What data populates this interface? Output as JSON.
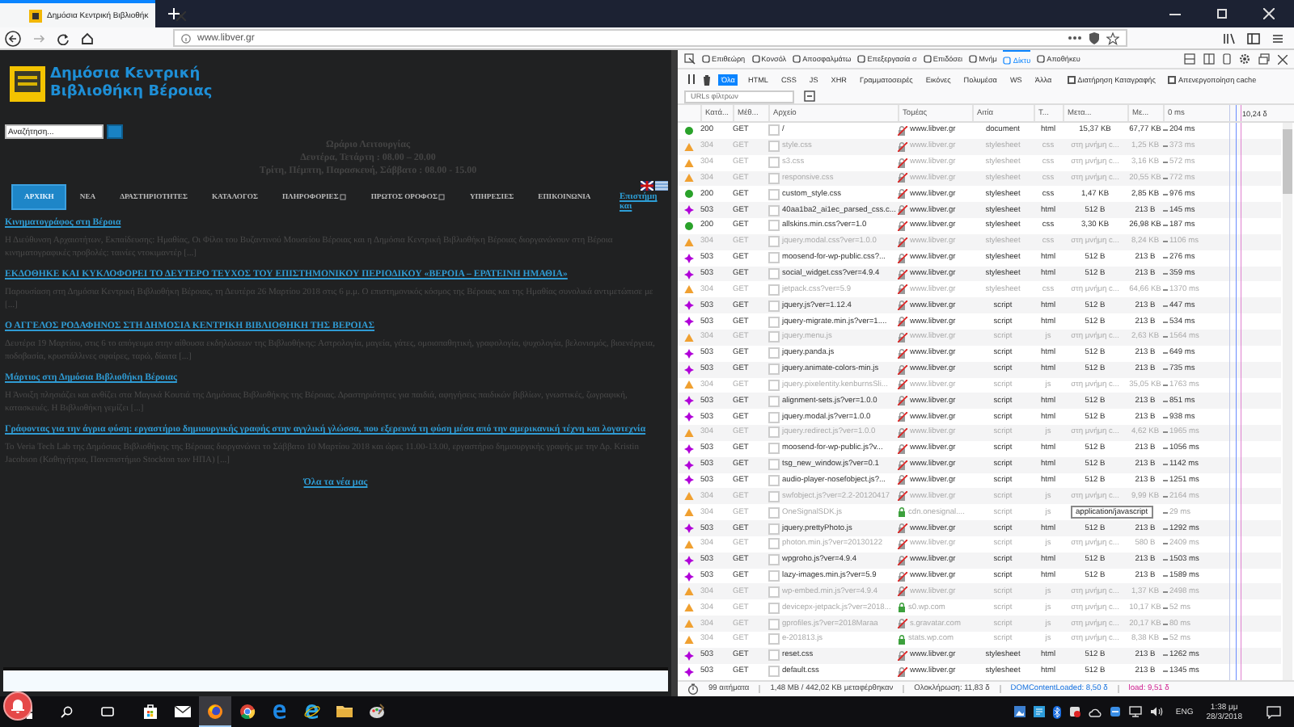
{
  "browser": {
    "tab_title": "Δημόσια Κεντρική Βιβλιοθήκ",
    "url": "www.libver.gr"
  },
  "site": {
    "logo_lines": [
      "Δημόσια Κεντρική",
      "Βιβλιοθήκη Βέροιας"
    ],
    "search_placeholder": "Αναζήτηση...",
    "hours": [
      "Ωράριο Λειτουργίας",
      "Δευτέρα, Τετάρτη : 08.00 – 20.00",
      "Τρίτη, Πέμπτη, Παρασκευή, Σάββατο : 08.00 - 15.00"
    ],
    "nav": [
      {
        "label": "ΑΡΧΙΚΗ",
        "selected": true,
        "submenu": false
      },
      {
        "label": "ΝΕΑ",
        "selected": false,
        "submenu": false
      },
      {
        "label": "ΔΡΑΣΤΗΡΙΟΤΗΤΕΣ",
        "selected": false,
        "submenu": false
      },
      {
        "label": "ΚΑΤΑΛΟΓΟΣ",
        "selected": false,
        "submenu": false
      },
      {
        "label": "ΠΛΗΡΟΦΟΡΙΕΣ",
        "selected": false,
        "submenu": true
      },
      {
        "label": "ΠΡΩΤΟΣ ΟΡΟΦΟΣ",
        "selected": false,
        "submenu": true
      },
      {
        "label": "ΥΠΗΡΕΣΙΕΣ",
        "selected": false,
        "submenu": false
      },
      {
        "label": "ΕΠΙΚΟΙΝΩΝΙΑ",
        "selected": false,
        "submenu": false
      }
    ],
    "side_link": "Επιστήμη και",
    "news": [
      {
        "title": "Κινηματογράφος στη Βέροια",
        "excerpt": "Η Διεύθυνση Αρχαιοτήτων, Εκπαίδευσης: Ημαθίας, Οι Φίλοι του Βυζαντινού Μουσείου Βέροιας και η Δημόσια Κεντρική Βιβλιοθήκη Βέροιας διοργανώνουν στη Βέροια κινηματογραφικές προβολές: ταινίες ντοκιμαντέρ [...]"
      },
      {
        "title": "ΕΚΔΟΘΗΚΕ ΚΑΙ ΚΥΚΛΟΦΟΡΕΙ ΤΟ ΔΕΥΤΕΡΟ ΤΕΥΧΟΣ ΤΟΥ ΕΠΙΣΤΗΜΟΝΙΚΟΥ ΠΕΡΙΟΔΙΚΟΥ «ΒΕΡΟΙΑ – ΕΡΑΤΕΙΝΗ ΗΜΑΘΙΑ»",
        "excerpt": "Παρουσίαση στη Δημόσια Κεντρική Βιβλιοθήκη Βέροιας, τη Δευτέρα 26 Μαρτίου 2018 στις 6 μ.μ. Ο επιστημονικός κόσμος της Βέροιας και της Ημαθίας συνολικά αντιμετώπισε με [...]"
      },
      {
        "title": "Ο ΑΓΓΕΛΟΣ ΡΟΔΑΦΗΝΟΣ ΣΤΗ ΔΗΜΟΣΙΑ ΚΕΝΤΡΙΚΗ ΒΙΒΛΙΟΘΗΚΗ ΤΗΣ ΒΕΡΟΙΑΣ",
        "excerpt": "Δευτέρα 19 Μαρτίου, στις 6 το απόγευμα στην αίθουσα εκδηλώσεων της Βιβλιοθήκης: Αστρολογία, μαγεία, γάτες, ομοιοπαθητική, γραφολογία, ψυχολογία, βελονισμός, βιοενέργεια, ποδοβασία, κρυστάλλινες σφαίρες, ταρώ, δίαιτα [...]"
      },
      {
        "title": "Μάρτιος στη Δημόσια Βιβλιοθήκη Βέροιας",
        "excerpt": "Η Άνοιξη πλησιάζει και ανθίζει στα Μαγικά Κουτιά της Δημόσιας Βιβλιοθήκης της Βέροιας. Δραστηριότητες για παιδιά, αφηγήσεις παιδικών βιβλίων, γνωστικές, ζωγραφική, κατασκευές. Η Βιβλιοθήκη γεμίζει [...]"
      },
      {
        "title": "Γράφοντας για την άγρια φύση: εργαστήριο δημιουργικής γραφής στην αγγλική γλώσσα, που εξερευνά τη φύση μέσα από την αμερικανική τέχνη και λογοτεχνία",
        "excerpt": "Το Veria Tech Lab της Δημόσιας Βιβλιοθήκης της Βέροιας διοργανώνει το Σάββατο 10 Μαρτίου 2018 και ώρες 11.00-13.00, εργαστήριο δημιουργικής γραφής με την Δρ. Kristin Jacobson (Καθηγήτρια, Πανεπιστήμιο Stockton των ΗΠΑ) [...]"
      }
    ],
    "all_news": "Όλα τα νέα μας"
  },
  "devtools": {
    "tools": [
      {
        "label": "Επιθεώρη",
        "selected": false
      },
      {
        "label": "Κονσόλ",
        "selected": false
      },
      {
        "label": "Αποσφαλμάτω",
        "selected": false
      },
      {
        "label": "Επεξεργασία σ",
        "selected": false
      },
      {
        "label": "Επιδόσει",
        "selected": false
      },
      {
        "label": "Μνήμ",
        "selected": false
      },
      {
        "label": "Δίκτυ",
        "selected": true
      },
      {
        "label": "Αποθήκευ",
        "selected": false
      }
    ],
    "filters": [
      {
        "label": "Όλα",
        "selected": true
      },
      {
        "label": "HTML",
        "selected": false
      },
      {
        "label": "CSS",
        "selected": false
      },
      {
        "label": "JS",
        "selected": false
      },
      {
        "label": "XHR",
        "selected": false
      },
      {
        "label": "Γραμματοσειρές",
        "selected": false
      },
      {
        "label": "Εικόνες",
        "selected": false
      },
      {
        "label": "Πολυμέσα",
        "selected": false
      },
      {
        "label": "WS",
        "selected": false
      },
      {
        "label": "Άλλα",
        "selected": false
      }
    ],
    "options": [
      {
        "label": "Διατήρηση Καταγραφής",
        "checked": false
      },
      {
        "label": "Απενεργοποίηση cache",
        "checked": false
      }
    ],
    "url_filter_placeholder": "URLs φίλτρων",
    "columns": [
      "Κατά...",
      "Μέθ...",
      "Αρχείο",
      "Τομέας",
      "Αιτία",
      "Τ...",
      "Μετα...",
      "Με...",
      "0 ms"
    ],
    "timeline_label": "10,24 δ",
    "requests": [
      {
        "kind": "ok",
        "status": "200",
        "method": "GET",
        "file": "/",
        "domain": "www.libver.gr",
        "secure": false,
        "cause": "document",
        "type": "html",
        "transferred": "15,37 KB",
        "size": "67,77 KB",
        "time": "204 ms"
      },
      {
        "kind": "cached",
        "status": "304",
        "method": "GET",
        "file": "style.css",
        "domain": "www.libver.gr",
        "secure": false,
        "cause": "stylesheet",
        "type": "css",
        "transferred": "στη μνήμη c...",
        "size": "1,25 KB",
        "time": "373 ms"
      },
      {
        "kind": "cached",
        "status": "304",
        "method": "GET",
        "file": "s3.css",
        "domain": "www.libver.gr",
        "secure": false,
        "cause": "stylesheet",
        "type": "css",
        "transferred": "στη μνήμη c...",
        "size": "3,16 KB",
        "time": "572 ms"
      },
      {
        "kind": "cached",
        "status": "304",
        "method": "GET",
        "file": "responsive.css",
        "domain": "www.libver.gr",
        "secure": false,
        "cause": "stylesheet",
        "type": "css",
        "transferred": "στη μνήμη c...",
        "size": "20,55 KB",
        "time": "772 ms"
      },
      {
        "kind": "ok",
        "status": "200",
        "method": "GET",
        "file": "custom_style.css",
        "domain": "www.libver.gr",
        "secure": false,
        "cause": "stylesheet",
        "type": "css",
        "transferred": "1,47 KB",
        "size": "2,85 KB",
        "time": "976 ms"
      },
      {
        "kind": "error",
        "status": "503",
        "method": "GET",
        "file": "40aa1ba2_ai1ec_parsed_css.c...",
        "domain": "www.libver.gr",
        "secure": false,
        "cause": "stylesheet",
        "type": "html",
        "transferred": "512 B",
        "size": "213 B",
        "time": "145 ms"
      },
      {
        "kind": "ok",
        "status": "200",
        "method": "GET",
        "file": "allskins.min.css?ver=1.0",
        "domain": "www.libver.gr",
        "secure": false,
        "cause": "stylesheet",
        "type": "css",
        "transferred": "3,30 KB",
        "size": "26,98 KB",
        "time": "187 ms"
      },
      {
        "kind": "cached",
        "status": "304",
        "method": "GET",
        "file": "jquery.modal.css?ver=1.0.0",
        "domain": "www.libver.gr",
        "secure": false,
        "cause": "stylesheet",
        "type": "css",
        "transferred": "στη μνήμη c...",
        "size": "8,24 KB",
        "time": "1106 ms"
      },
      {
        "kind": "error",
        "status": "503",
        "method": "GET",
        "file": "moosend-for-wp-public.css?...",
        "domain": "www.libver.gr",
        "secure": false,
        "cause": "stylesheet",
        "type": "html",
        "transferred": "512 B",
        "size": "213 B",
        "time": "276 ms"
      },
      {
        "kind": "error",
        "status": "503",
        "method": "GET",
        "file": "social_widget.css?ver=4.9.4",
        "domain": "www.libver.gr",
        "secure": false,
        "cause": "stylesheet",
        "type": "html",
        "transferred": "512 B",
        "size": "213 B",
        "time": "359 ms"
      },
      {
        "kind": "cached",
        "status": "304",
        "method": "GET",
        "file": "jetpack.css?ver=5.9",
        "domain": "www.libver.gr",
        "secure": false,
        "cause": "stylesheet",
        "type": "css",
        "transferred": "στη μνήμη c...",
        "size": "64,66 KB",
        "time": "1370 ms"
      },
      {
        "kind": "error",
        "status": "503",
        "method": "GET",
        "file": "jquery.js?ver=1.12.4",
        "domain": "www.libver.gr",
        "secure": false,
        "cause": "script",
        "type": "html",
        "transferred": "512 B",
        "size": "213 B",
        "time": "447 ms"
      },
      {
        "kind": "error",
        "status": "503",
        "method": "GET",
        "file": "jquery-migrate.min.js?ver=1....",
        "domain": "www.libver.gr",
        "secure": false,
        "cause": "script",
        "type": "html",
        "transferred": "512 B",
        "size": "213 B",
        "time": "534 ms"
      },
      {
        "kind": "cached",
        "status": "304",
        "method": "GET",
        "file": "jquery.menu.js",
        "domain": "www.libver.gr",
        "secure": false,
        "cause": "script",
        "type": "js",
        "transferred": "στη μνήμη c...",
        "size": "2,63 KB",
        "time": "1564 ms"
      },
      {
        "kind": "error",
        "status": "503",
        "method": "GET",
        "file": "jquery.panda.js",
        "domain": "www.libver.gr",
        "secure": false,
        "cause": "script",
        "type": "html",
        "transferred": "512 B",
        "size": "213 B",
        "time": "649 ms"
      },
      {
        "kind": "error",
        "status": "503",
        "method": "GET",
        "file": "jquery.animate-colors-min.js",
        "domain": "www.libver.gr",
        "secure": false,
        "cause": "script",
        "type": "html",
        "transferred": "512 B",
        "size": "213 B",
        "time": "735 ms"
      },
      {
        "kind": "cached",
        "status": "304",
        "method": "GET",
        "file": "jquery.pixelentity.kenburnsSli...",
        "domain": "www.libver.gr",
        "secure": false,
        "cause": "script",
        "type": "js",
        "transferred": "στη μνήμη c...",
        "size": "35,05 KB",
        "time": "1763 ms"
      },
      {
        "kind": "error",
        "status": "503",
        "method": "GET",
        "file": "alignment-sets.js?ver=1.0.0",
        "domain": "www.libver.gr",
        "secure": false,
        "cause": "script",
        "type": "html",
        "transferred": "512 B",
        "size": "213 B",
        "time": "851 ms"
      },
      {
        "kind": "error",
        "status": "503",
        "method": "GET",
        "file": "jquery.modal.js?ver=1.0.0",
        "domain": "www.libver.gr",
        "secure": false,
        "cause": "script",
        "type": "html",
        "transferred": "512 B",
        "size": "213 B",
        "time": "938 ms"
      },
      {
        "kind": "cached",
        "status": "304",
        "method": "GET",
        "file": "jquery.redirect.js?ver=1.0.0",
        "domain": "www.libver.gr",
        "secure": false,
        "cause": "script",
        "type": "js",
        "transferred": "στη μνήμη c...",
        "size": "4,62 KB",
        "time": "1965 ms"
      },
      {
        "kind": "error",
        "status": "503",
        "method": "GET",
        "file": "moosend-for-wp-public.js?v...",
        "domain": "www.libver.gr",
        "secure": false,
        "cause": "script",
        "type": "html",
        "transferred": "512 B",
        "size": "213 B",
        "time": "1056 ms"
      },
      {
        "kind": "error",
        "status": "503",
        "method": "GET",
        "file": "tsg_new_window.js?ver=0.1",
        "domain": "www.libver.gr",
        "secure": false,
        "cause": "script",
        "type": "html",
        "transferred": "512 B",
        "size": "213 B",
        "time": "1142 ms"
      },
      {
        "kind": "error",
        "status": "503",
        "method": "GET",
        "file": "audio-player-nosefobject.js?...",
        "domain": "www.libver.gr",
        "secure": false,
        "cause": "script",
        "type": "html",
        "transferred": "512 B",
        "size": "213 B",
        "time": "1251 ms"
      },
      {
        "kind": "cached",
        "status": "304",
        "method": "GET",
        "file": "swfobject.js?ver=2.2-20120417",
        "domain": "www.libver.gr",
        "secure": false,
        "cause": "script",
        "type": "js",
        "transferred": "στη μνήμη c...",
        "size": "9,99 KB",
        "time": "2164 ms"
      },
      {
        "kind": "cached",
        "status": "304",
        "method": "GET",
        "file": "OneSignalSDK.js",
        "domain": "cdn.onesignal....",
        "secure": true,
        "cause": "script",
        "type": "js",
        "time": "29 ms",
        "tooltip": "application/javascript"
      },
      {
        "kind": "error",
        "status": "503",
        "method": "GET",
        "file": "jquery.prettyPhoto.js",
        "domain": "www.libver.gr",
        "secure": false,
        "cause": "script",
        "type": "html",
        "transferred": "512 B",
        "size": "213 B",
        "time": "1292 ms"
      },
      {
        "kind": "cached",
        "status": "304",
        "method": "GET",
        "file": "photon.min.js?ver=20130122",
        "domain": "www.libver.gr",
        "secure": false,
        "cause": "script",
        "type": "js",
        "transferred": "στη μνήμη c...",
        "size": "580 B",
        "time": "2409 ms"
      },
      {
        "kind": "error",
        "status": "503",
        "method": "GET",
        "file": "wpgroho.js?ver=4.9.4",
        "domain": "www.libver.gr",
        "secure": false,
        "cause": "script",
        "type": "html",
        "transferred": "512 B",
        "size": "213 B",
        "time": "1503 ms"
      },
      {
        "kind": "error",
        "status": "503",
        "method": "GET",
        "file": "lazy-images.min.js?ver=5.9",
        "domain": "www.libver.gr",
        "secure": false,
        "cause": "script",
        "type": "html",
        "transferred": "512 B",
        "size": "213 B",
        "time": "1589 ms"
      },
      {
        "kind": "cached",
        "status": "304",
        "method": "GET",
        "file": "wp-embed.min.js?ver=4.9.4",
        "domain": "www.libver.gr",
        "secure": false,
        "cause": "script",
        "type": "js",
        "transferred": "στη μνήμη c...",
        "size": "1,37 KB",
        "time": "2498 ms"
      },
      {
        "kind": "cached",
        "status": "304",
        "method": "GET",
        "file": "devicepx-jetpack.js?ver=2018...",
        "domain": "s0.wp.com",
        "secure": true,
        "cause": "script",
        "type": "js",
        "transferred": "στη μνήμη c...",
        "size": "10,17 KB",
        "time": "52 ms"
      },
      {
        "kind": "cached",
        "status": "304",
        "method": "GET",
        "file": "gprofiles.js?ver=2018Maraa",
        "domain": "s.gravatar.com",
        "secure": false,
        "cause": "script",
        "type": "js",
        "transferred": "στη μνήμη c...",
        "size": "20,17 KB",
        "time": "80 ms"
      },
      {
        "kind": "cached",
        "status": "304",
        "method": "GET",
        "file": "e-201813.js",
        "domain": "stats.wp.com",
        "secure": true,
        "cause": "script",
        "type": "js",
        "transferred": "στη μνήμη c...",
        "size": "8,38 KB",
        "time": "52 ms"
      },
      {
        "kind": "error",
        "status": "503",
        "method": "GET",
        "file": "reset.css",
        "domain": "www.libver.gr",
        "secure": false,
        "cause": "stylesheet",
        "type": "html",
        "transferred": "512 B",
        "size": "213 B",
        "time": "1262 ms"
      },
      {
        "kind": "error",
        "status": "503",
        "method": "GET",
        "file": "default.css",
        "domain": "www.libver.gr",
        "secure": false,
        "cause": "stylesheet",
        "type": "html",
        "transferred": "512 B",
        "size": "213 B",
        "time": "1345 ms"
      }
    ],
    "summary": [
      {
        "kind": "plain",
        "text": "99 αιτήματα"
      },
      {
        "kind": "plain",
        "text": "1,48 MB / 442,02 KB μεταφέρθηκαν"
      },
      {
        "kind": "plain",
        "text": "Ολοκλήρωση: 11,83 δ"
      },
      {
        "kind": "dom",
        "text": "DOMContentLoaded: 8,50 δ"
      },
      {
        "kind": "load",
        "text": "load: 9,51 δ"
      }
    ]
  },
  "taskbar": {
    "apps": [
      {
        "kind": "store",
        "active": false
      },
      {
        "kind": "mail",
        "active": false
      },
      {
        "kind": "firefox",
        "active": true
      },
      {
        "kind": "chrome",
        "active": false
      },
      {
        "kind": "edge",
        "active": false
      },
      {
        "kind": "ie",
        "active": false
      },
      {
        "kind": "folder",
        "active": false
      },
      {
        "kind": "paint",
        "active": false
      }
    ],
    "language": "ENG",
    "time": "1:38 μμ",
    "date": "28/3/2018"
  }
}
